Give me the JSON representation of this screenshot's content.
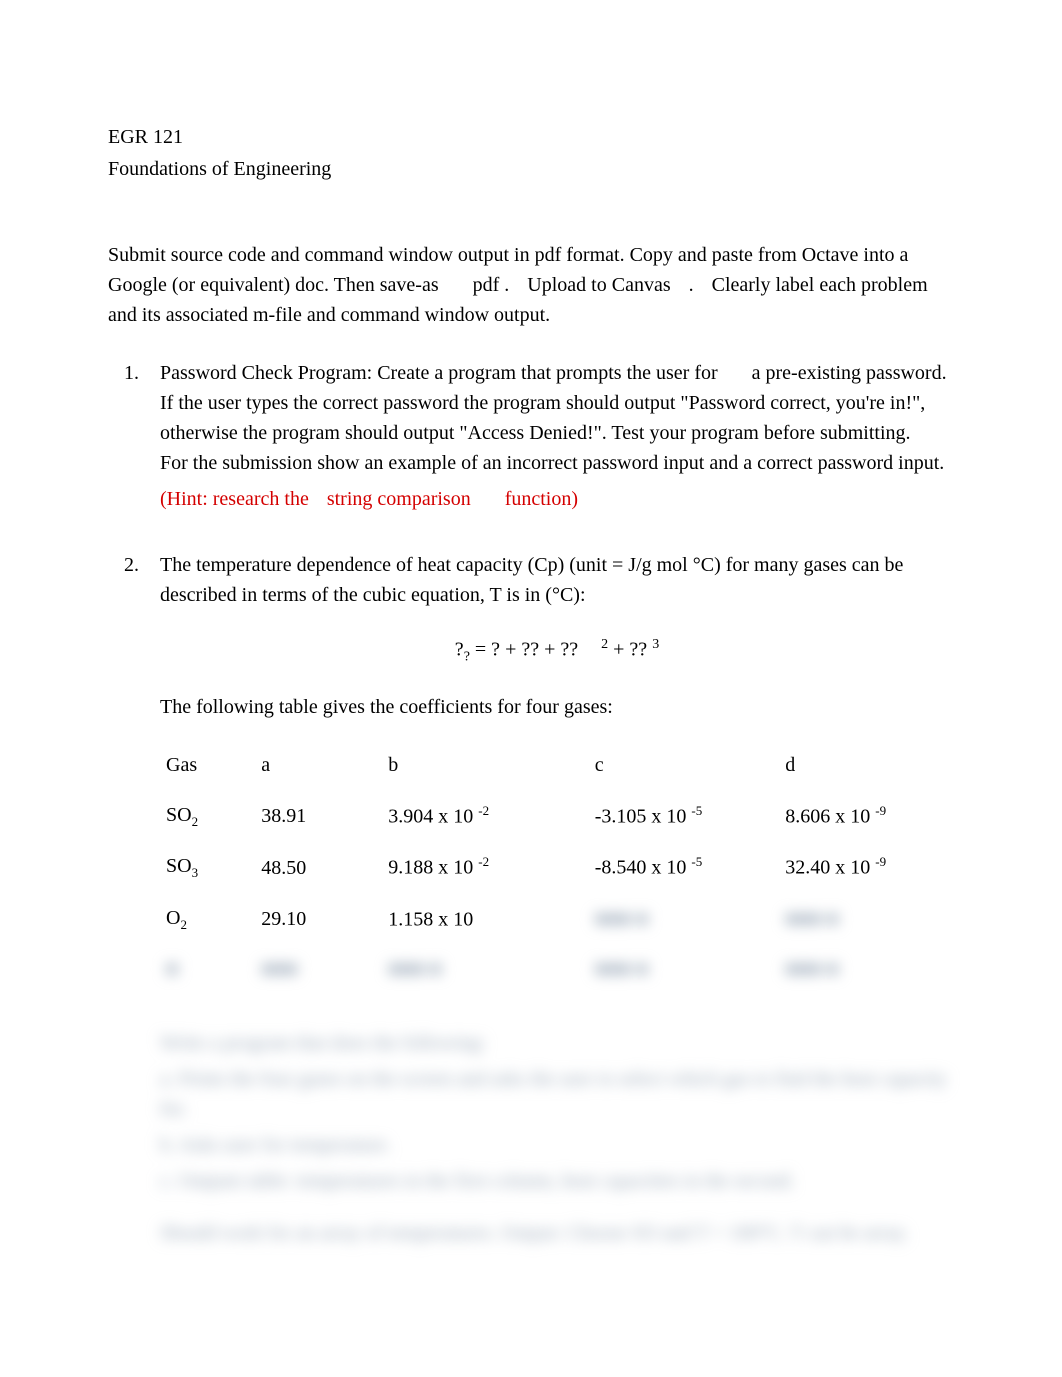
{
  "header": {
    "line1": "EGR 121",
    "line2": "Foundations of Engineering"
  },
  "intro": {
    "text": "Submit source code and command window output in pdf format. Copy and paste from Octave into a Google (or equivalent) doc. Then save-as",
    "pdf": "pdf .",
    "upload": "Upload to Canvas",
    "period": ".",
    "tail": "Clearly label each problem and its associated m-file and command window output."
  },
  "problems": [
    {
      "num": "1.",
      "body": "Password Check Program: Create a program that prompts the user for",
      "body_tail": "a pre-existing password. If the user types the correct password the program should output \"Password correct, you're in!\", otherwise the program should output \"Access Denied!\". Test your program before submitting.",
      "body_mid": "For the submission show an example of an incorrect password input and a correct password input.",
      "hint_prefix": "(Hint: research the",
      "hint_mid": "string comparison",
      "hint_suffix": "function)"
    },
    {
      "num": "2.",
      "body": "The temperature dependence of heat capacity (Cp) (unit = J/g mol °C) for many gases can be described in terms of the cubic equation, T is in (°C):",
      "equation": {
        "lhs_base": "?",
        "lhs_sub": "?",
        "eq": " = ? + ?? + ?? ",
        "exp2": "2",
        "plus": " + ?? ",
        "exp3": "3"
      },
      "table_intro": "The following table gives the coefficients for four gases:",
      "table": {
        "headers": [
          "Gas",
          "a",
          "b",
          "c",
          "d"
        ],
        "rows": [
          {
            "gas_base": "SO",
            "gas_sub": "2",
            "a": "38.91",
            "b_m": "3.904 x 10",
            "b_e": "-2",
            "c_m": "-3.105 x 10",
            "c_e": "-5",
            "d_m": "8.606 x 10",
            "d_e": "-9"
          },
          {
            "gas_base": "SO",
            "gas_sub": "3",
            "a": "48.50",
            "b_m": "9.188 x 10",
            "b_e": "-2",
            "c_m": "-8.540 x 10",
            "c_e": "-5",
            "d_m": "32.40 x 10",
            "d_e": "-9"
          },
          {
            "gas_base": "O",
            "gas_sub": "2",
            "a": "29.10",
            "b_m": "1.158 x 10",
            "b_e": "",
            "c_m": "■■■ ■",
            "c_e": "",
            "d_m": "■■■ ■",
            "d_e": ""
          },
          {
            "gas_base": "■",
            "gas_sub": "",
            "a": "■■■",
            "b_m": "■■■ ■",
            "b_e": "",
            "c_m": "■■■ ■",
            "c_e": "",
            "d_m": "■■■ ■",
            "d_e": ""
          }
        ]
      }
    }
  ],
  "blurred_after": {
    "l1": "Write a program that does the following:",
    "l2": "a.   Prints the four gases on the screen and asks the user to select which gas to find the heat capacity for.",
    "l3": "b.   Asks user for temperature.",
    "l4": "c.   Outputs table: temperatures in the first column, heat capacities in the second.",
    "l5": "Should work for an array of temperatures.       Output: Choose SO       and T = 100°C. T       can be array."
  }
}
